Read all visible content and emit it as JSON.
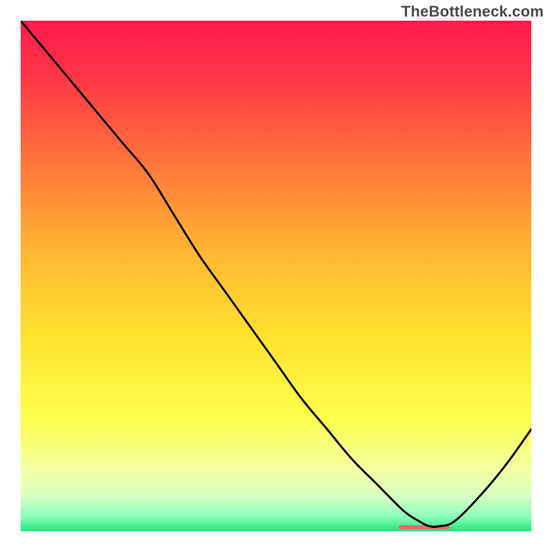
{
  "watermark": "TheBottleneck.com",
  "chart_data": {
    "type": "line",
    "title": "",
    "xlabel": "",
    "ylabel": "",
    "xlim": [
      0,
      100
    ],
    "ylim": [
      0,
      100
    ],
    "grid": false,
    "legend": false,
    "annotations": [],
    "curve": {
      "name": "bottleneck-curve",
      "x": [
        0,
        5,
        10,
        15,
        20,
        25,
        30,
        35,
        40,
        45,
        50,
        55,
        60,
        65,
        70,
        75,
        78,
        80,
        82,
        85,
        90,
        95,
        100
      ],
      "y": [
        100,
        94,
        88,
        82,
        76,
        70,
        62,
        54,
        47,
        40,
        33,
        26,
        20,
        14,
        9,
        4,
        2,
        1,
        1,
        2,
        7,
        13,
        20
      ]
    },
    "highlight_segment": {
      "name": "optimal-range-marker",
      "x_start": 74,
      "x_end": 84,
      "y": 0.8,
      "color": "#d6706d"
    },
    "gradient_stops": [
      {
        "pos": 0.0,
        "color": "#ff1a4b"
      },
      {
        "pos": 0.1,
        "color": "#ff3348"
      },
      {
        "pos": 0.25,
        "color": "#ff6a3c"
      },
      {
        "pos": 0.45,
        "color": "#ffb531"
      },
      {
        "pos": 0.62,
        "color": "#ffe22e"
      },
      {
        "pos": 0.78,
        "color": "#fdff4d"
      },
      {
        "pos": 0.88,
        "color": "#f3ffa3"
      },
      {
        "pos": 0.93,
        "color": "#d8ffc0"
      },
      {
        "pos": 0.97,
        "color": "#8fffbe"
      },
      {
        "pos": 1.0,
        "color": "#23e57b"
      }
    ]
  }
}
